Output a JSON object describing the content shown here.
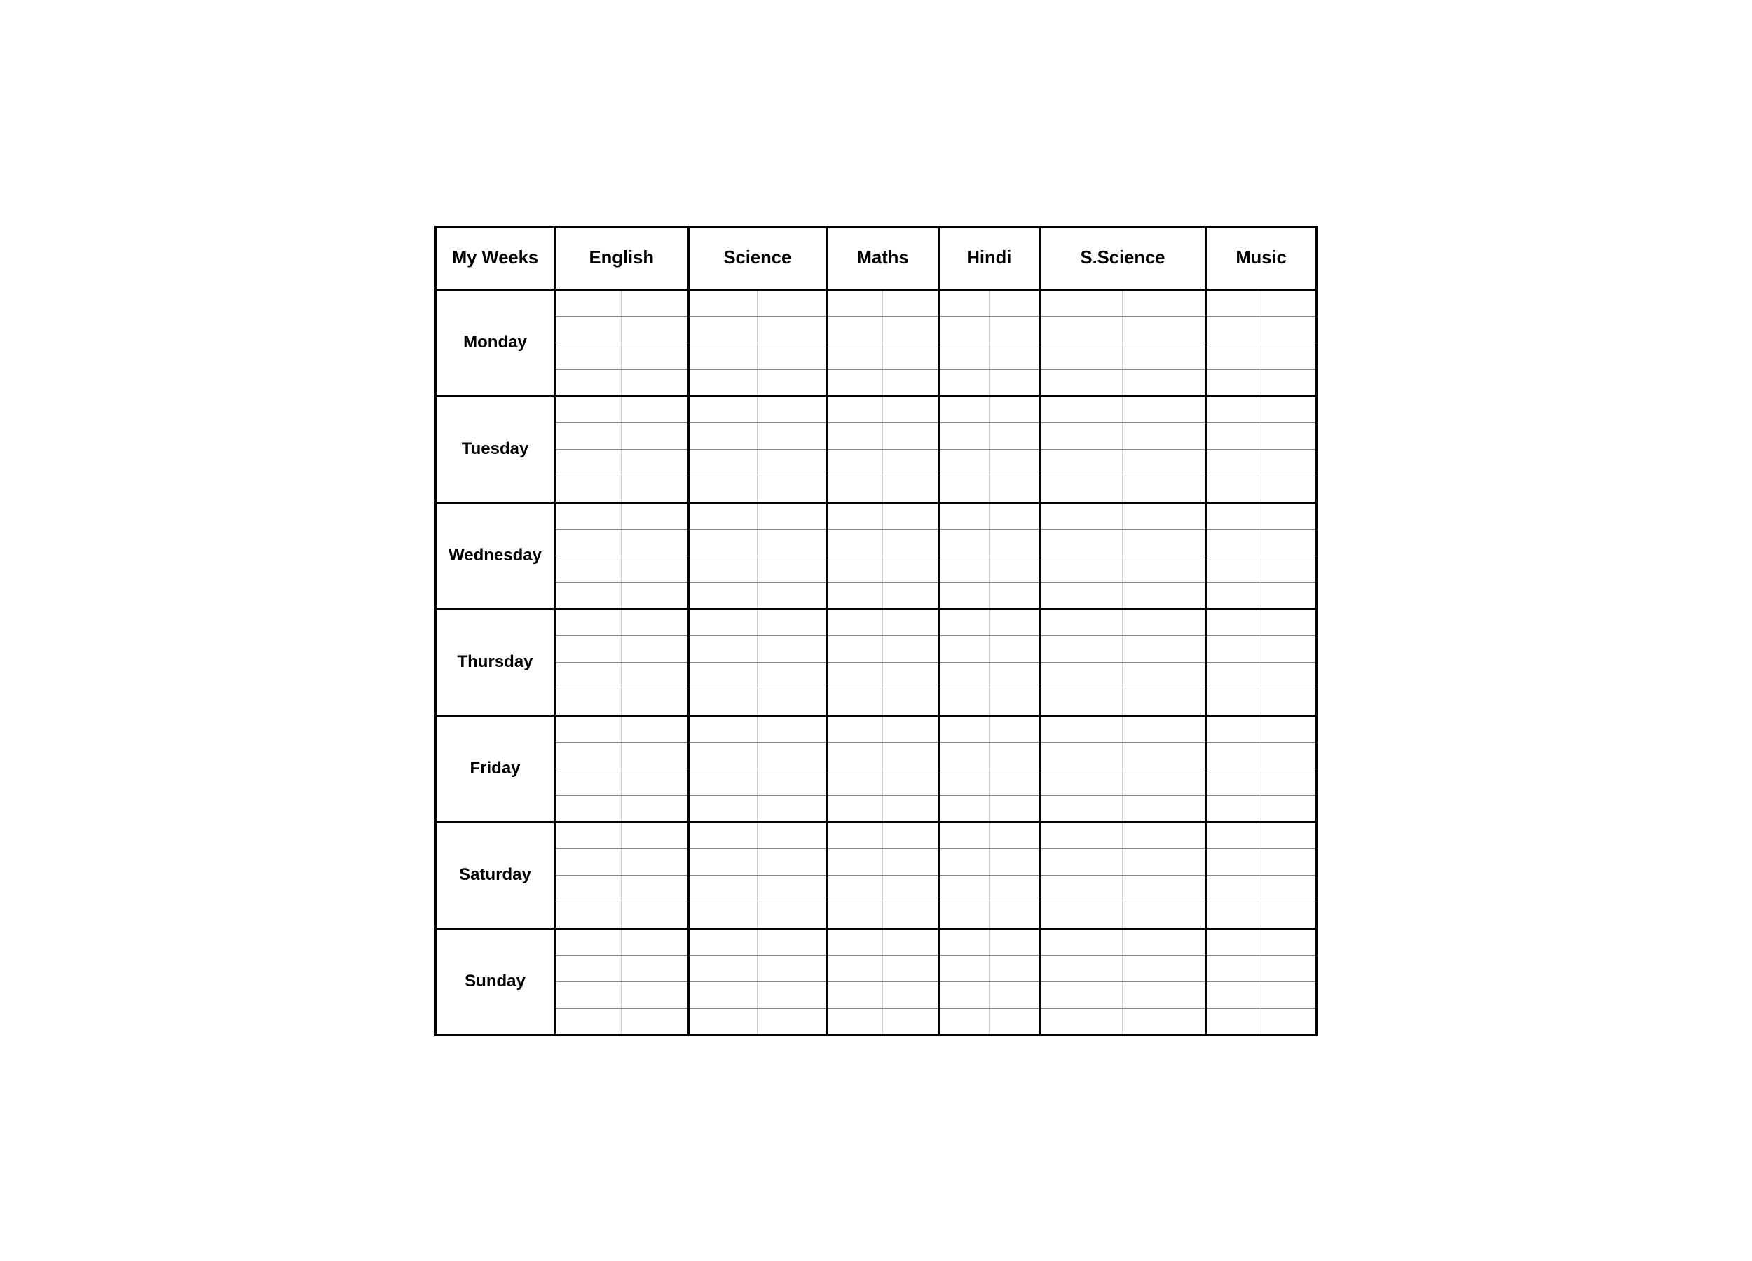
{
  "table": {
    "corner_label": "My Weeks",
    "subjects": [
      "English",
      "Science",
      "Maths",
      "Hindi",
      "S.Science",
      "Music"
    ],
    "days": [
      "Monday",
      "Tuesday",
      "Wednesday",
      "Thursday",
      "Friday",
      "Saturday",
      "Sunday"
    ],
    "sub_rows_per_day": 4
  }
}
